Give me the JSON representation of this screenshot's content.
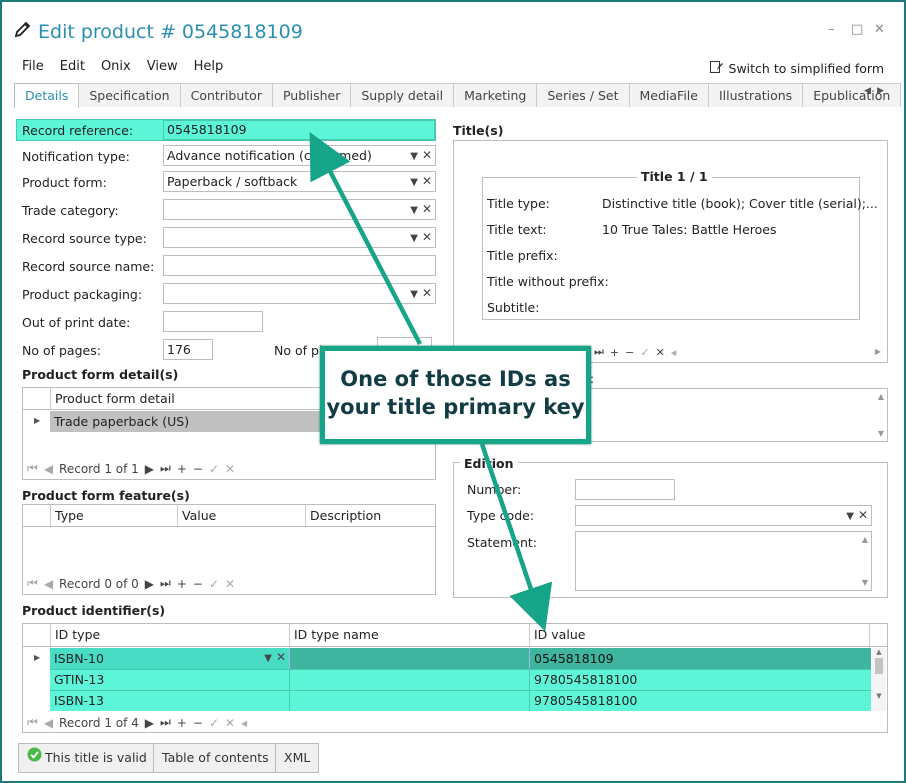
{
  "window": {
    "title": "Edit product # 0545818109",
    "controls": [
      "–",
      "□",
      "✕"
    ]
  },
  "menu": [
    "File",
    "Edit",
    "Onix",
    "View",
    "Help"
  ],
  "simplified_label": "Switch to simplified form",
  "tabs": [
    "Details",
    "Specification",
    "Contributor",
    "Publisher",
    "Supply detail",
    "Marketing",
    "Series / Set",
    "MediaFile",
    "Illustrations",
    "Epublication"
  ],
  "form": {
    "record_reference": {
      "label": "Record reference:",
      "value": "0545818109"
    },
    "notification_type": {
      "label": "Notification type:",
      "value": "Advance notification (confirmed)"
    },
    "product_form": {
      "label": "Product form:",
      "value": "Paperback / softback"
    },
    "trade_category": {
      "label": "Trade category:",
      "value": ""
    },
    "record_source_type": {
      "label": "Record source type:",
      "value": ""
    },
    "record_source_name": {
      "label": "Record source name:",
      "value": ""
    },
    "product_packaging": {
      "label": "Product packaging:",
      "value": ""
    },
    "out_of_print_date": {
      "label": "Out of print date:",
      "value": ""
    },
    "no_of_pages": {
      "label": "No of pages:",
      "value": "176"
    },
    "no_of_pieces": {
      "label": "No of pi"
    }
  },
  "product_form_detail": {
    "title": "Product form detail(s)",
    "header": "Product form detail",
    "rows": [
      "Trade paperback (US)"
    ],
    "nav": "Record 1 of 1"
  },
  "product_form_feature": {
    "title": "Product form feature(s)",
    "headers": [
      "Type",
      "Value",
      "Description"
    ],
    "nav": "Record 0 of 0"
  },
  "titles": {
    "title": "Title(s)",
    "legend": "Title 1 / 1",
    "rows": [
      {
        "label": "Title type:",
        "value": "Distinctive title (book); Cover title (serial);..."
      },
      {
        "label": "Title text:",
        "value": "10 True Tales: Battle Heroes"
      },
      {
        "label": "Title prefix:",
        "value": ""
      },
      {
        "label": "Title without prefix:",
        "value": ""
      },
      {
        "label": "Subtitle:",
        "value": ""
      }
    ],
    "partial_label": "n:"
  },
  "edition": {
    "legend": "Edition",
    "number": "Number:",
    "type_code": "Type code:",
    "statement": "Statement:"
  },
  "identifiers": {
    "title": "Product identifier(s)",
    "headers": [
      "ID type",
      "ID type name",
      "ID value"
    ],
    "rows": [
      {
        "type": "ISBN-10",
        "name": "",
        "value": "0545818109"
      },
      {
        "type": "GTIN-13",
        "name": "",
        "value": "9780545818100"
      },
      {
        "type": "ISBN-13",
        "name": "",
        "value": "9780545818100"
      }
    ],
    "nav": "Record 1 of 4"
  },
  "callout": {
    "line1": "One of those IDs as",
    "line2": "your title primary key"
  },
  "buttons": {
    "valid": "This title is valid",
    "toc": "Table of contents",
    "xml": "XML"
  },
  "colors": {
    "accent": "#2b8fb3",
    "highlight": "#5cf5d8",
    "arrow": "#17a58a"
  }
}
